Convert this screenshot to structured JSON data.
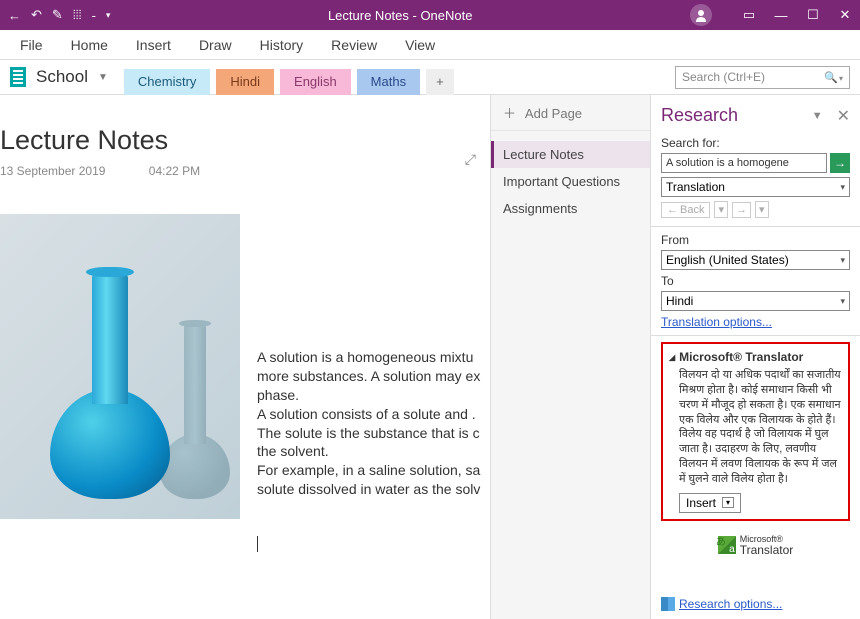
{
  "titlebar": {
    "title": "Lecture Notes  -  OneNote"
  },
  "menubar": {
    "items": [
      "File",
      "Home",
      "Insert",
      "Draw",
      "History",
      "Review",
      "View"
    ]
  },
  "notebook": {
    "label": "School"
  },
  "tabs": {
    "active": "Chemistry",
    "hindi": "Hindi",
    "english": "English",
    "maths": "Maths",
    "add": "+"
  },
  "search": {
    "placeholder": "Search (Ctrl+E)"
  },
  "page": {
    "title": "Lecture Notes",
    "date": "13 September 2019",
    "time": "04:22 PM",
    "body": {
      "p1": "A solution is a homogeneous mixtu",
      "p2": "more substances. A solution may ex",
      "p3": "phase.",
      "p4": "A solution consists of a solute and .",
      "p5": "The solute is the substance that is c",
      "p6": "the solvent.",
      "p7": "For example, in a saline solution, sa",
      "p8": "solute dissolved in water as the solv"
    }
  },
  "pagelist": {
    "addpage": "Add Page",
    "items": [
      "Lecture Notes",
      "Important Questions",
      "Assignments"
    ]
  },
  "research": {
    "header": "Research",
    "search_for_label": "Search for:",
    "search_value": "A solution is a homogene",
    "service": "Translation",
    "back": "Back",
    "from_label": "From",
    "from_value": "English (United States)",
    "to_label": "To",
    "to_value": "Hindi",
    "options_link": "Translation options...",
    "translator_src": "Microsoft® Translator",
    "translated_text": "विलयन दो या अधिक पदार्थों का सजातीय मिश्रण होता है। कोई समाधान किसी भी चरण में मौजूद हो सकता है।   एक समाधान एक विलेय और एक विलायक के होते हैं। विलेय वह पदार्थ है जो विलायक में घुल जाता है।   उदाहरण के लिए, लवणीय विलयन में लवण विलायक के रूप में जल में घुलने वाले विलेय होता है।",
    "insert": "Insert",
    "brand_small": "Microsoft®",
    "brand": "Translator",
    "research_options": "Research options..."
  }
}
